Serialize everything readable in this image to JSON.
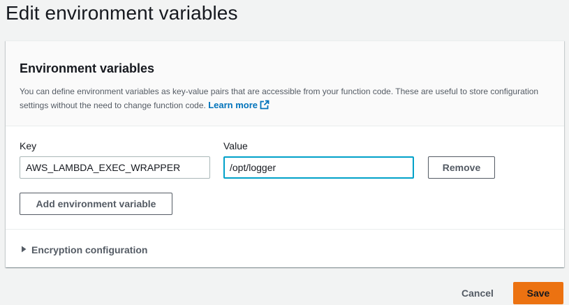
{
  "page": {
    "title": "Edit environment variables"
  },
  "panel": {
    "heading": "Environment variables",
    "description": "You can define environment variables as key-value pairs that are accessible from your function code. These are useful to store configuration settings without the need to change function code.",
    "learn_more_label": "Learn more",
    "learn_more_icon": "external-link-icon"
  },
  "env_vars": {
    "key_label": "Key",
    "value_label": "Value",
    "rows": [
      {
        "key": "AWS_LAMBDA_EXEC_WRAPPER",
        "value": "/opt/logger",
        "remove_label": "Remove"
      }
    ],
    "add_label": "Add environment variable"
  },
  "encryption": {
    "label": "Encryption configuration",
    "expanded": false,
    "icon": "caret-right-icon"
  },
  "footer": {
    "cancel_label": "Cancel",
    "save_label": "Save"
  },
  "colors": {
    "accent_link": "#0073bb",
    "primary_button": "#ec7211",
    "focus_border": "#00a1c9"
  }
}
